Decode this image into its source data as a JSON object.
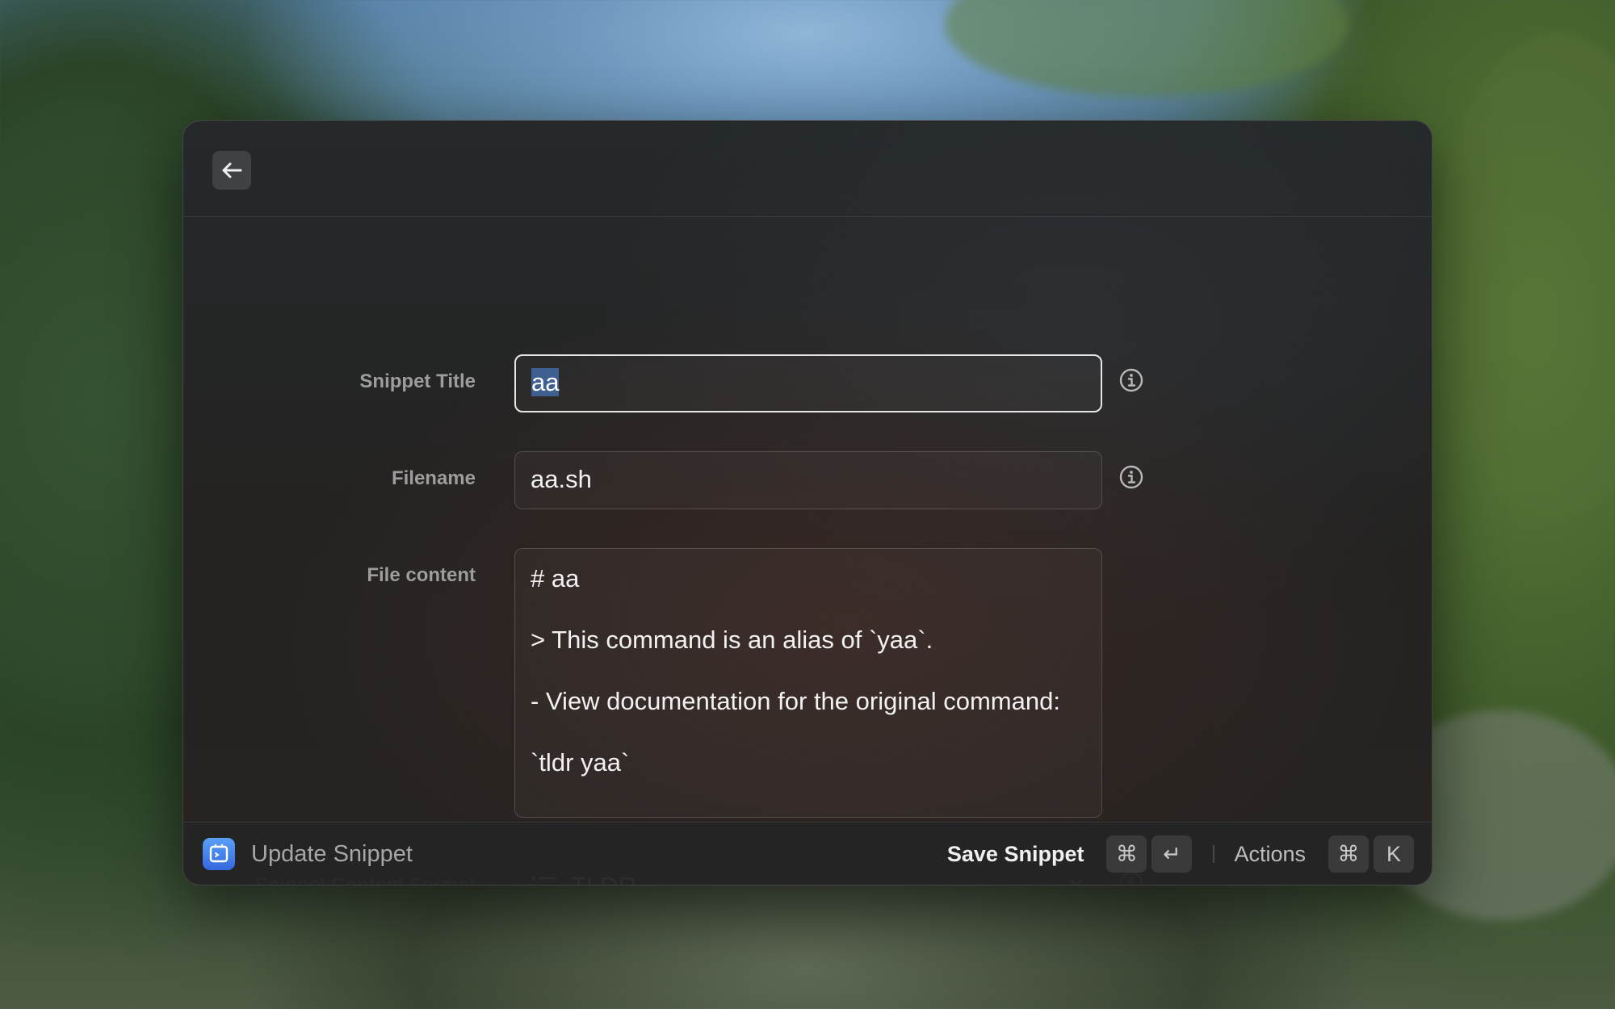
{
  "window": {
    "back_icon": "arrow-left-icon"
  },
  "form": {
    "title": {
      "label": "Snippet Title",
      "value": "aa"
    },
    "filename": {
      "label": "Filename",
      "value": "aa.sh"
    },
    "content": {
      "label": "File content",
      "lines": [
        "# aa",
        "> This command is an alias of `yaa`.",
        "- View documentation for the original command:",
        "`tldr yaa`"
      ]
    },
    "format": {
      "label": "Snippet Content Format",
      "value": "TLDR",
      "icon": "list-icon"
    }
  },
  "footer": {
    "app_title": "Update Snippet",
    "primary_action": "Save Snippet",
    "primary_shortcut": [
      "⌘",
      "↵"
    ],
    "secondary_action": "Actions",
    "secondary_shortcut": [
      "⌘",
      "K"
    ]
  },
  "colors": {
    "accent": "#3568e0",
    "selection": "#3f5f91"
  }
}
